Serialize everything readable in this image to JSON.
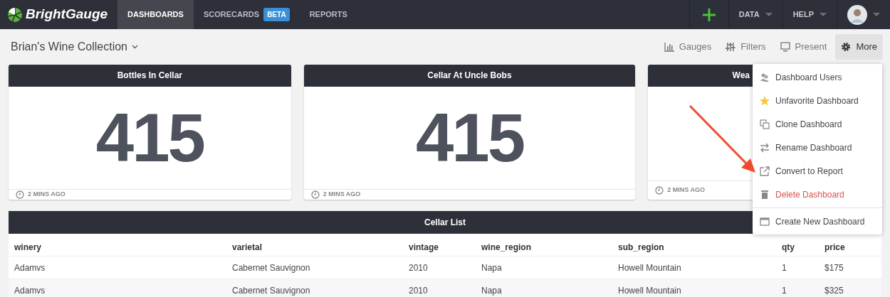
{
  "app": {
    "brand": "BrightGauge"
  },
  "nav": [
    {
      "label": "DASHBOARDS",
      "selected": true
    },
    {
      "label": "SCORECARDS",
      "selected": false,
      "badge": "BETA"
    },
    {
      "label": "REPORTS",
      "selected": false
    }
  ],
  "nav_right": [
    {
      "kind": "add"
    },
    {
      "kind": "menu",
      "label": "DATA"
    },
    {
      "kind": "menu",
      "label": "HELP"
    },
    {
      "kind": "avatar"
    }
  ],
  "dashboard": {
    "title": "Brian's Wine Collection"
  },
  "toolbar": [
    {
      "kind": "gauges",
      "label": "Gauges",
      "selected": false
    },
    {
      "kind": "filters",
      "label": "Filters",
      "selected": false
    },
    {
      "kind": "present",
      "label": "Present",
      "selected": false
    },
    {
      "kind": "more",
      "label": "More",
      "selected": true
    }
  ],
  "gauges": [
    {
      "title": "Bottles In Cellar",
      "value": "415",
      "updated": "2 MINS AGO"
    },
    {
      "title": "Cellar At Uncle Bobs",
      "value": "415",
      "updated": "2 MINS AGO"
    },
    {
      "title": "Wea",
      "updated": "2 MINS AGO"
    }
  ],
  "more_menu": [
    {
      "kind": "users",
      "label": "Dashboard Users"
    },
    {
      "kind": "star",
      "label": "Unfavorite Dashboard"
    },
    {
      "kind": "clone",
      "label": "Clone Dashboard"
    },
    {
      "kind": "rename",
      "label": "Rename Dashboard"
    },
    {
      "kind": "convert",
      "label": "Convert to Report"
    },
    {
      "kind": "delete",
      "label": "Delete Dashboard"
    },
    {
      "kind": "create",
      "label": "Create New Dashboard"
    }
  ],
  "table": {
    "title": "Cellar List",
    "columns": [
      "winery",
      "varietal",
      "vintage",
      "wine_region",
      "sub_region",
      "qty",
      "price"
    ],
    "rows": [
      [
        "Adamvs",
        "Cabernet Sauvignon",
        "2010",
        "Napa",
        "Howell Mountain",
        "1",
        "$175"
      ],
      [
        "Adamvs",
        "Cabernet Sauvignon",
        "2010",
        "Napa",
        "Howell Mountain",
        "1",
        "$325"
      ]
    ]
  }
}
